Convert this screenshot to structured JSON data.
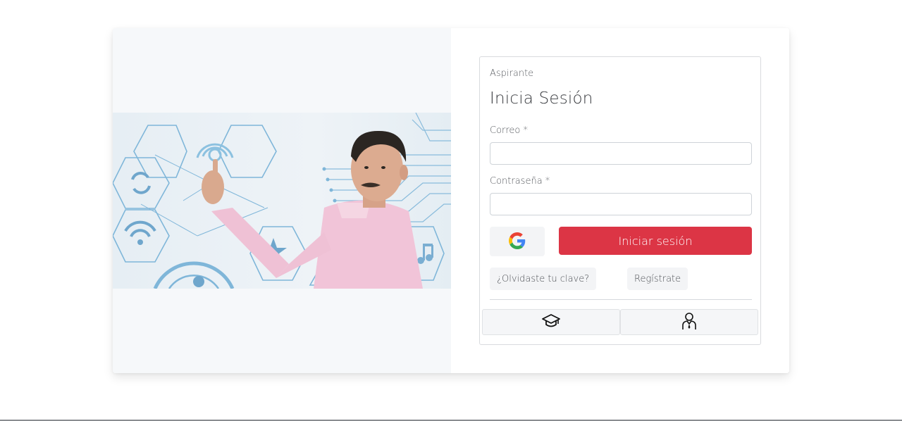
{
  "login": {
    "role_label": "Aspirante",
    "title": "Inicia Sesión",
    "email_label": "Correo *",
    "email_value": "",
    "password_label": "Contraseña *",
    "password_value": "",
    "submit_label": "Iniciar sesión",
    "forgot_label": "¿Olvidaste tu clave?",
    "register_label": "Regístrate"
  },
  "icons": {
    "google": "google-icon",
    "student": "graduation-cap-icon",
    "staff": "person-tie-icon",
    "hero": "man-touching-hexagon-network-photo"
  },
  "colors": {
    "primary": "#dc3545",
    "panel_bg": "#f6f8fa",
    "hex_lines": "#7fb6d9"
  }
}
